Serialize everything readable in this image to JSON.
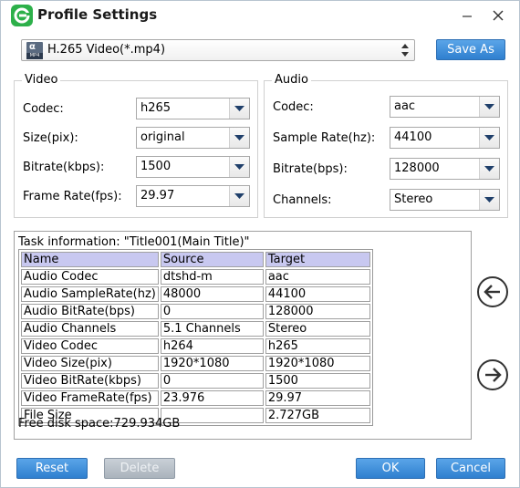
{
  "window": {
    "title": "Profile Settings"
  },
  "profile": {
    "value": "H.265 Video(*.mp4)",
    "icon_format": "MP4",
    "save_as_label": "Save As"
  },
  "video": {
    "group_label": "Video",
    "codec": {
      "label": "Codec:",
      "value": "h265"
    },
    "size": {
      "label": "Size(pix):",
      "value": "original"
    },
    "bitrate": {
      "label": "Bitrate(kbps):",
      "value": "1500"
    },
    "frame_rate": {
      "label": "Frame Rate(fps):",
      "value": "29.97"
    }
  },
  "audio": {
    "group_label": "Audio",
    "codec": {
      "label": "Codec:",
      "value": "aac"
    },
    "sample_rate": {
      "label": "Sample Rate(hz):",
      "value": "44100"
    },
    "bitrate": {
      "label": "Bitrate(bps):",
      "value": "128000"
    },
    "channels": {
      "label": "Channels:",
      "value": "Stereo"
    }
  },
  "task": {
    "info_text": "Task information: \"Title001(Main Title)\"",
    "headers": [
      "Name",
      "Source",
      "Target"
    ],
    "rows": [
      [
        "Audio Codec",
        "dtshd-m",
        "aac"
      ],
      [
        "Audio SampleRate(hz)",
        "48000",
        "44100"
      ],
      [
        "Audio BitRate(bps)",
        "0",
        "128000"
      ],
      [
        "Audio Channels",
        "5.1 Channels",
        "Stereo"
      ],
      [
        "Video Codec",
        "h264",
        "h265"
      ],
      [
        "Video Size(pix)",
        "1920*1080",
        "1920*1080"
      ],
      [
        "Video BitRate(kbps)",
        "0",
        "1500"
      ],
      [
        "Video FrameRate(fps)",
        "23.976",
        "29.97"
      ],
      [
        "File Size",
        "",
        "2.727GB"
      ]
    ],
    "free_disk": "Free disk space:729.934GB"
  },
  "buttons": {
    "reset": "Reset",
    "delete": "Delete",
    "ok": "OK",
    "cancel": "Cancel"
  },
  "colors": {
    "accent": "#2f7fcf",
    "header_row": "#c8c8f0",
    "app_icon": "#2db04a"
  }
}
